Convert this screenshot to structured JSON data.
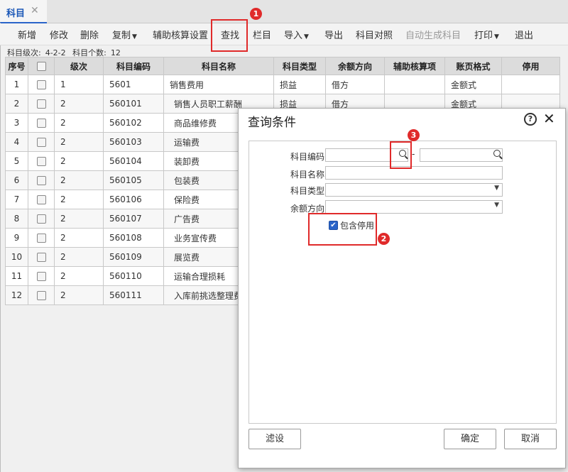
{
  "tab": {
    "label": "科目",
    "close": "✕"
  },
  "toolbar": {
    "add": "新增",
    "edit": "修改",
    "delete": "删除",
    "copy": "复制",
    "aux_settings": "辅助核算设置",
    "find": "查找",
    "columns": "栏目",
    "import": "导入",
    "export": "导出",
    "compare": "科目对照",
    "auto_generate": "自动生成科目",
    "print": "打印",
    "exit": "退出"
  },
  "info": {
    "level_label": "科目级次:",
    "level_value": "4-2-2",
    "count_label": "科目个数:",
    "count_value": "12"
  },
  "table": {
    "headers": [
      "序号",
      "",
      "级次",
      "科目编码",
      "科目名称",
      "科目类型",
      "余额方向",
      "辅助核算项",
      "账页格式",
      "停用"
    ],
    "rows": [
      {
        "no": "1",
        "level": "1",
        "code": "5601",
        "name": "销售费用",
        "type": "损益",
        "dir": "借方",
        "aux": "",
        "fmt": "金额式"
      },
      {
        "no": "2",
        "level": "2",
        "code": "560101",
        "name": "销售人员职工薪酬",
        "type": "损益",
        "dir": "借方",
        "aux": "",
        "fmt": "金额式"
      },
      {
        "no": "3",
        "level": "2",
        "code": "560102",
        "name": "商品维修费",
        "type": "",
        "dir": "",
        "aux": "",
        "fmt": ""
      },
      {
        "no": "4",
        "level": "2",
        "code": "560103",
        "name": "运输费",
        "type": "",
        "dir": "",
        "aux": "",
        "fmt": ""
      },
      {
        "no": "5",
        "level": "2",
        "code": "560104",
        "name": "装卸费",
        "type": "",
        "dir": "",
        "aux": "",
        "fmt": ""
      },
      {
        "no": "6",
        "level": "2",
        "code": "560105",
        "name": "包装费",
        "type": "",
        "dir": "",
        "aux": "",
        "fmt": ""
      },
      {
        "no": "7",
        "level": "2",
        "code": "560106",
        "name": "保险费",
        "type": "",
        "dir": "",
        "aux": "",
        "fmt": ""
      },
      {
        "no": "8",
        "level": "2",
        "code": "560107",
        "name": "广告费",
        "type": "",
        "dir": "",
        "aux": "",
        "fmt": ""
      },
      {
        "no": "9",
        "level": "2",
        "code": "560108",
        "name": "业务宣传费",
        "type": "",
        "dir": "",
        "aux": "",
        "fmt": ""
      },
      {
        "no": "10",
        "level": "2",
        "code": "560109",
        "name": "展览费",
        "type": "",
        "dir": "",
        "aux": "",
        "fmt": ""
      },
      {
        "no": "11",
        "level": "2",
        "code": "560110",
        "name": "运输合理损耗",
        "type": "",
        "dir": "",
        "aux": "",
        "fmt": ""
      },
      {
        "no": "12",
        "level": "2",
        "code": "560111",
        "name": "入库前挑选整理费",
        "type": "",
        "dir": "",
        "aux": "",
        "fmt": ""
      }
    ]
  },
  "dialog": {
    "title": "查询条件",
    "code_label": "科目编码",
    "range_sep": "-",
    "name_label": "科目名称",
    "type_label": "科目类型",
    "direction_label": "余额方向",
    "include_disabled_label": "包含停用",
    "include_disabled_checked": true,
    "filter_button": "滤设",
    "ok_button": "确定",
    "cancel_button": "取消"
  },
  "annotations": {
    "badge1": "1",
    "badge2": "2",
    "badge3": "3",
    "color": "#e02a2a"
  }
}
